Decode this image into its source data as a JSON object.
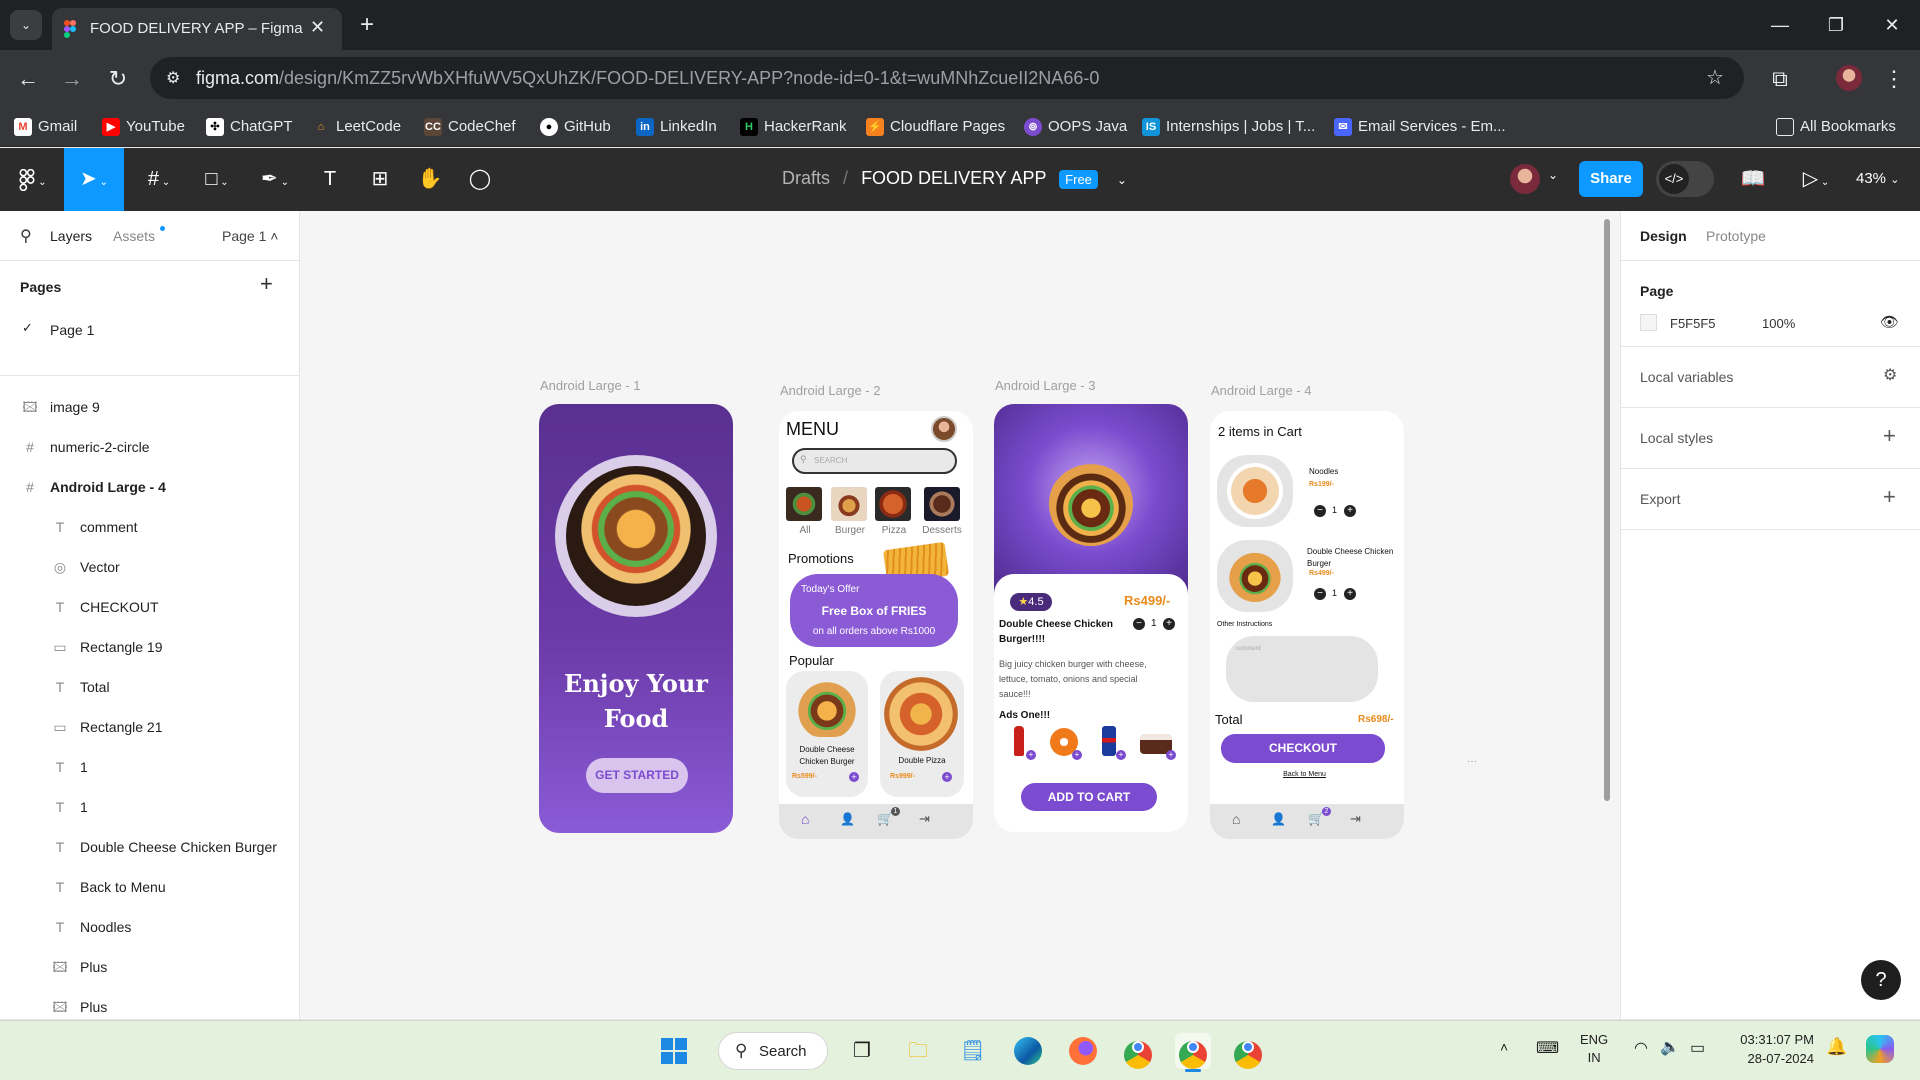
{
  "browser": {
    "tab_title": "FOOD DELIVERY APP – Figma",
    "url_domain": "figma.com",
    "url_path": "/design/KmZZ5rvWbXHfuWV5QxUhZK/FOOD-DELIVERY-APP?node-id=0-1&t=wuMNhZcueII2NA66-0",
    "bookmarks": [
      "Gmail",
      "YouTube",
      "ChatGPT",
      "LeetCode",
      "CodeChef",
      "GitHub",
      "LinkedIn",
      "HackerRank",
      "Cloudflare Pages",
      "OOPS Java",
      "Internships | Jobs | T...",
      "Email Services - Em..."
    ],
    "all_bookmarks": "All Bookmarks"
  },
  "figma": {
    "breadcrumb_drafts": "Drafts",
    "breadcrumb_sep": "/",
    "file_name": "FOOD DELIVERY APP",
    "plan_badge": "Free",
    "share_label": "Share",
    "zoom": "43%"
  },
  "left_panel": {
    "tab_layers": "Layers",
    "tab_assets": "Assets",
    "page_selector": "Page 1",
    "pages_heading": "Pages",
    "pages": [
      "Page 1"
    ],
    "layers": [
      {
        "name": "image 9",
        "icon": "image"
      },
      {
        "name": "numeric-2-circle",
        "icon": "frame"
      },
      {
        "name": "Android Large - 4",
        "icon": "frame"
      },
      {
        "name": "comment",
        "icon": "text"
      },
      {
        "name": "Vector",
        "icon": "vector"
      },
      {
        "name": "CHECKOUT",
        "icon": "text"
      },
      {
        "name": "Rectangle 19",
        "icon": "rect"
      },
      {
        "name": "Total",
        "icon": "text"
      },
      {
        "name": "Rectangle 21",
        "icon": "rect"
      },
      {
        "name": "1",
        "icon": "text"
      },
      {
        "name": "1",
        "icon": "text"
      },
      {
        "name": "Double Cheese Chicken Burger",
        "icon": "text"
      },
      {
        "name": "Back to Menu",
        "icon": "text"
      },
      {
        "name": "Noodles",
        "icon": "text"
      },
      {
        "name": "Plus",
        "icon": "image"
      },
      {
        "name": "Plus",
        "icon": "image"
      }
    ]
  },
  "right_panel": {
    "tab_design": "Design",
    "tab_prototype": "Prototype",
    "page_heading": "Page",
    "bg_hex": "F5F5F5",
    "bg_opacity": "100%",
    "local_variables": "Local variables",
    "local_styles": "Local styles",
    "export": "Export"
  },
  "frames": {
    "f1": {
      "label": "Android Large - 1",
      "title_line1": "Enjoy Your",
      "title_line2": "Food",
      "cta": "GET STARTED"
    },
    "f2": {
      "label": "Android Large - 2",
      "menu": "MENU",
      "search": "SEARCH",
      "categories": [
        "All",
        "Burger",
        "Pizza",
        "Desserts"
      ],
      "promotions": "Promotions",
      "offer_line1": "Today's Offer",
      "offer_line2": "Free Box of FRIES",
      "offer_line3": "on all orders above Rs1000",
      "popular": "Popular",
      "item1_name": "Double Cheese Chicken Burger",
      "item1_price": "Rs599/-",
      "item2_name": "Double Pizza",
      "item2_price": "Rs999/-",
      "cart_count": "1"
    },
    "f3": {
      "label": "Android Large - 3",
      "rating": "4.5",
      "price": "Rs499/-",
      "name": "Double Cheese Chicken Burger!!!!",
      "qty": "1",
      "desc": "Big juicy chicken burger with cheese, lettuce, tomato, onions and special sauce!!!",
      "addons": "Ads One!!!",
      "cta": "ADD TO CART"
    },
    "f4": {
      "label": "Android Large - 4",
      "heading": "2 items in Cart",
      "item1_name": "Noodles",
      "item1_price": "Rs199/-",
      "item1_qty": "1",
      "item2_name": "Double Cheese Chicken Burger",
      "item2_price": "Rs499/-",
      "item2_qty": "1",
      "other": "Other Instructions",
      "comment_ph": "comment",
      "total_label": "Total",
      "total_value": "Rs698/-",
      "checkout": "CHECKOUT",
      "back": "Back to Menu",
      "cart_count": "2"
    }
  },
  "taskbar": {
    "search": "Search",
    "lang1": "ENG",
    "lang2": "IN",
    "time": "03:31:07 PM",
    "date": "28-07-2024"
  },
  "colors": {
    "purple": "#7b4ccf",
    "figma_blue": "#0d99ff",
    "price_orange": "#e98b1c"
  }
}
